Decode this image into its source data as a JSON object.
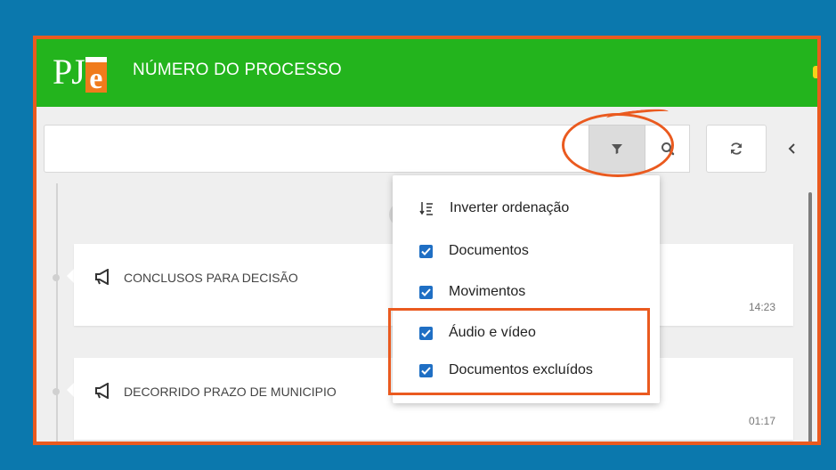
{
  "header": {
    "logo_text": "PJ",
    "logo_letter": "e",
    "title": "NÚMERO DO PROCESSO"
  },
  "toolbar": {
    "search_placeholder": "",
    "filter_icon": "filter-icon",
    "search_icon": "search-icon",
    "refresh_icon": "refresh-icon",
    "collapse_icon": "chevron-left-icon"
  },
  "menu": {
    "sort_label": "Inverter ordenação",
    "sort_icon": "sort-descending-icon",
    "items": [
      {
        "label": "Documentos",
        "checked": true
      },
      {
        "label": "Movimentos",
        "checked": true
      },
      {
        "label": "Áudio e vídeo",
        "checked": true
      },
      {
        "label": "Documentos excluídos",
        "checked": true
      }
    ]
  },
  "timeline": {
    "events": [
      {
        "text": "CONCLUSOS PARA DECISÃO",
        "time": "14:23",
        "icon": "megaphone-icon"
      },
      {
        "text": "DECORRIDO PRAZO DE MUNICIPIO",
        "time": "01:17",
        "icon": "megaphone-icon"
      }
    ]
  },
  "colors": {
    "background": "#0b78ad",
    "header": "#23b41d",
    "annotation": "#ea5a1f",
    "checkbox": "#1f6fc4",
    "logo_accent": "#f07b1c"
  }
}
